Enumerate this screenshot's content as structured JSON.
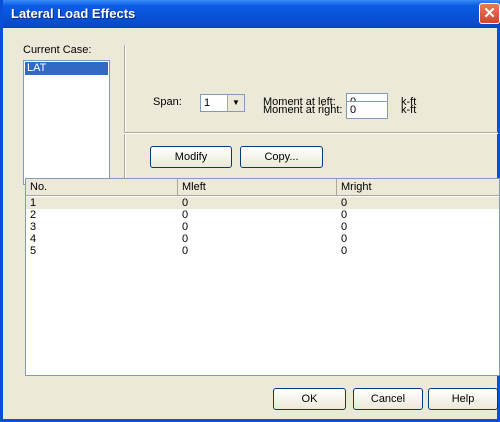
{
  "window": {
    "title": "Lateral Load Effects",
    "close_glyph": "✕"
  },
  "current_case": {
    "label": "Current Case:",
    "items": [
      "LAT"
    ]
  },
  "span": {
    "label": "Span:",
    "value": "1"
  },
  "moment_left": {
    "label": "Moment at left:",
    "value": "0",
    "unit": "k-ft"
  },
  "moment_right": {
    "label": "Moment at right:",
    "value": "0",
    "unit": "k-ft"
  },
  "buttons": {
    "modify": "Modify",
    "copy": "Copy...",
    "ok": "OK",
    "cancel": "Cancel",
    "help": "Help"
  },
  "table": {
    "columns": [
      "No.",
      "Mleft",
      "Mright"
    ],
    "rows": [
      [
        "1",
        "0",
        "0"
      ],
      [
        "2",
        "0",
        "0"
      ],
      [
        "3",
        "0",
        "0"
      ],
      [
        "4",
        "0",
        "0"
      ],
      [
        "5",
        "0",
        "0"
      ]
    ]
  },
  "colors": {
    "title_bar": "#0653d6",
    "selection": "#316ac5",
    "dialog_bg": "#ece9d8"
  }
}
